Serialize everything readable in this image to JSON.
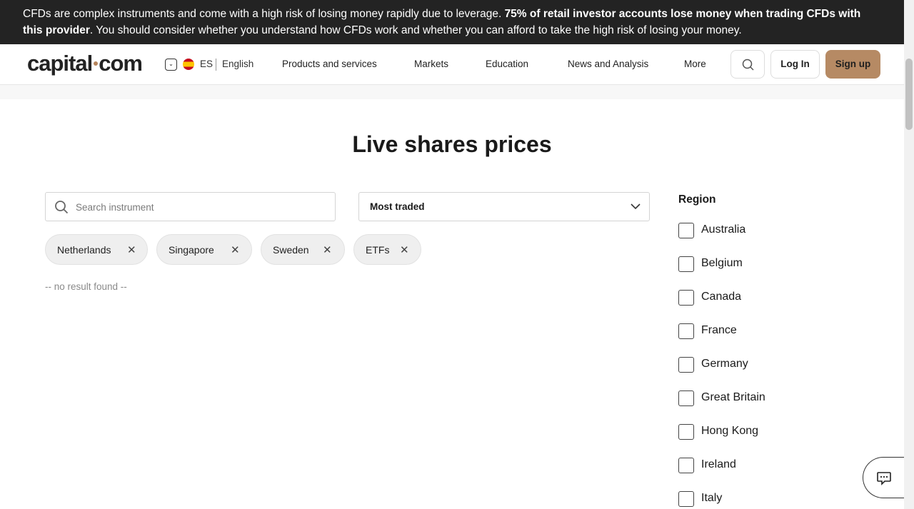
{
  "risk_banner": {
    "text_start": "CFDs are complex instruments and come with a high risk of losing money rapidly due to leverage. ",
    "text_bold": "75% of retail investor accounts lose money when trading CFDs with this provider",
    "text_end": ". You should consider whether you understand how CFDs work and whether you can afford to take the high risk of losing your money."
  },
  "header": {
    "logo_left": "capital",
    "logo_right": "com",
    "language_code": "ES",
    "language_name": "English",
    "nav": [
      {
        "label": "Products and services"
      },
      {
        "label": "Markets"
      },
      {
        "label": "Education"
      },
      {
        "label": "News and Analysis"
      },
      {
        "label": "More"
      }
    ],
    "search_icon": "search-icon",
    "login_label": "Log In",
    "signup_label": "Sign up",
    "accent_color": "#b68a64"
  },
  "main": {
    "title": "Live shares prices",
    "search_placeholder": "Search instrument",
    "sort_value": "Most traded",
    "filter_chips": [
      {
        "label": "Netherlands"
      },
      {
        "label": "Singapore"
      },
      {
        "label": "Sweden"
      },
      {
        "label": "ETFs"
      }
    ],
    "no_result": "-- no result found --"
  },
  "sidebar": {
    "region_title": "Region",
    "regions": [
      {
        "label": "Australia",
        "checked": false
      },
      {
        "label": "Belgium",
        "checked": false
      },
      {
        "label": "Canada",
        "checked": false
      },
      {
        "label": "France",
        "checked": false
      },
      {
        "label": "Germany",
        "checked": false
      },
      {
        "label": "Great Britain",
        "checked": false
      },
      {
        "label": "Hong Kong",
        "checked": false
      },
      {
        "label": "Ireland",
        "checked": false
      },
      {
        "label": "Italy",
        "checked": false
      }
    ]
  },
  "chat_icon": "chat-icon"
}
